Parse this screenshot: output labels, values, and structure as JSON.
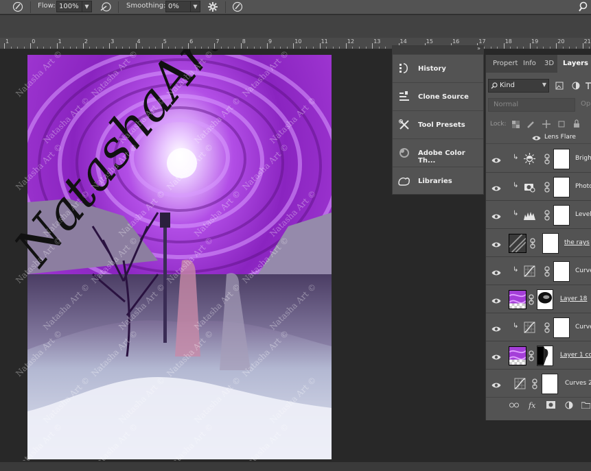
{
  "options_bar": {
    "flow_label": "Flow:",
    "flow_value": "100%",
    "smoothing_label": "Smoothing:",
    "smoothing_value": "0%",
    "icons": [
      "brush-icon",
      "airbrush-icon",
      "gear-icon",
      "pressure-icon",
      "search-icon"
    ]
  },
  "ruler": {
    "ticks": [
      "1",
      "0",
      "1",
      "2",
      "3",
      "4",
      "5",
      "6",
      "7",
      "8",
      "9",
      "10",
      "11",
      "12",
      "13",
      "14",
      "15",
      "16",
      "17",
      "18",
      "19",
      "20",
      "21"
    ]
  },
  "watermark": {
    "big_text": "NatashaArt",
    "repeat_text": "Natasha Art ©"
  },
  "collapsed_panels": {
    "items": [
      {
        "label": "History",
        "icon": "history-icon"
      },
      {
        "label": "Clone Source",
        "icon": "clone-source-icon"
      },
      {
        "label": "Tool Presets",
        "icon": "tool-presets-icon"
      },
      {
        "label": "Adobe Color Th...",
        "icon": "adobe-color-icon"
      },
      {
        "label": "Libraries",
        "icon": "libraries-icon"
      }
    ],
    "collapse_glyph": "»"
  },
  "layers_panel": {
    "tabs": [
      "Propert",
      "Info",
      "3D",
      "Layers"
    ],
    "active_tab": "Layers",
    "filter_value": "Kind",
    "blend_mode": "Normal",
    "opacity_label": "Opa",
    "lock_label": "Lock:",
    "effect_label": "Lens Flare",
    "layers": [
      {
        "name": "Brigh",
        "kind": "brightness"
      },
      {
        "name": "Photo",
        "kind": "photo-filter"
      },
      {
        "name": "Level",
        "kind": "levels"
      },
      {
        "name": "the rays",
        "kind": "pixel"
      },
      {
        "name": "Curve",
        "kind": "curves"
      },
      {
        "name": "Layer 18",
        "kind": "pixel"
      },
      {
        "name": "Curve",
        "kind": "curves"
      },
      {
        "name": "Layer 1 co",
        "kind": "pixel"
      },
      {
        "name": "Curves 2",
        "kind": "curves"
      }
    ],
    "footer_icons": [
      "link-icon",
      "fx-icon",
      "mask-icon",
      "adjustment-icon",
      "folder-icon"
    ],
    "fx_label": "fx"
  },
  "colors": {
    "ui_panel": "#535353",
    "ui_dark": "#282828",
    "sky_purple": "#9b30c8"
  }
}
